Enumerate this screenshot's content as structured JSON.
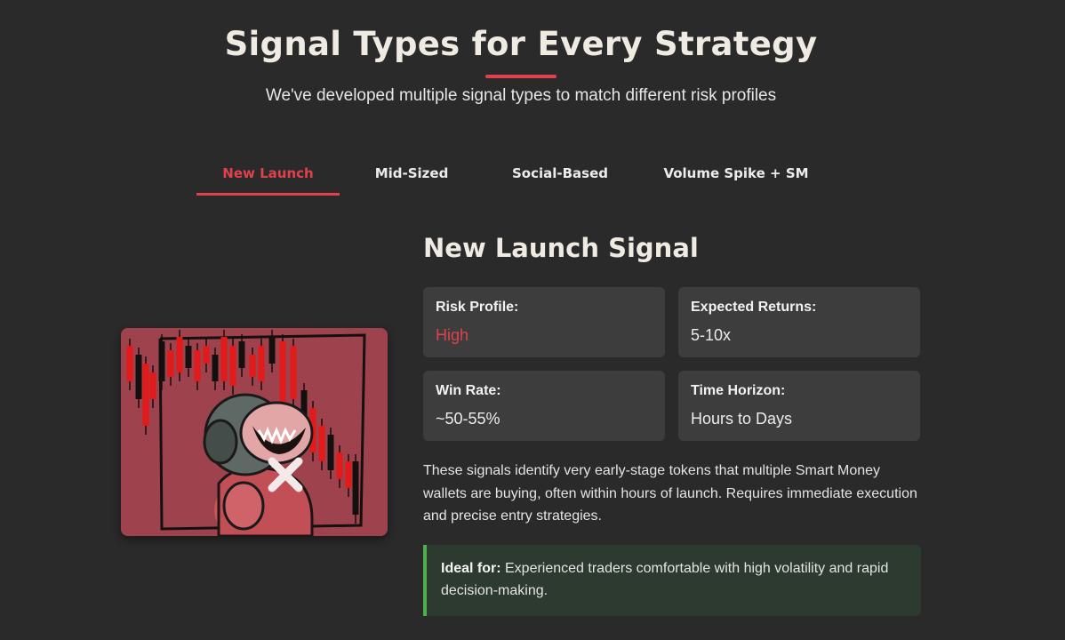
{
  "section": {
    "title": "Signal Types for Every Strategy",
    "subtitle": "We've developed multiple signal types to match different risk profiles",
    "accent_color": "#e0414d"
  },
  "tabs": [
    {
      "label": "New Launch",
      "active": true
    },
    {
      "label": "Mid-Sized",
      "active": false
    },
    {
      "label": "Social-Based",
      "active": false
    },
    {
      "label": "Volume Spike + SM",
      "active": false
    }
  ],
  "panel": {
    "title": "New Launch Signal",
    "image": "mascot-screaming-at-red-candlestick-chart",
    "stats": {
      "risk": {
        "label": "Risk Profile:",
        "value": "High",
        "color": "#e0414d"
      },
      "returns": {
        "label": "Expected Returns:",
        "value": "5-10x"
      },
      "winrate": {
        "label": "Win Rate:",
        "value": "~50-55%"
      },
      "horizon": {
        "label": "Time Horizon:",
        "value": "Hours to Days"
      }
    },
    "description": "These signals identify very early-stage tokens that multiple Smart Money wallets are buying, often within hours of launch. Requires immediate execution and precise entry strategies.",
    "ideal": {
      "label": "Ideal for:",
      "text": " Experienced traders comfortable with high volatility and rapid decision-making.",
      "border_color": "#4caf50"
    }
  }
}
